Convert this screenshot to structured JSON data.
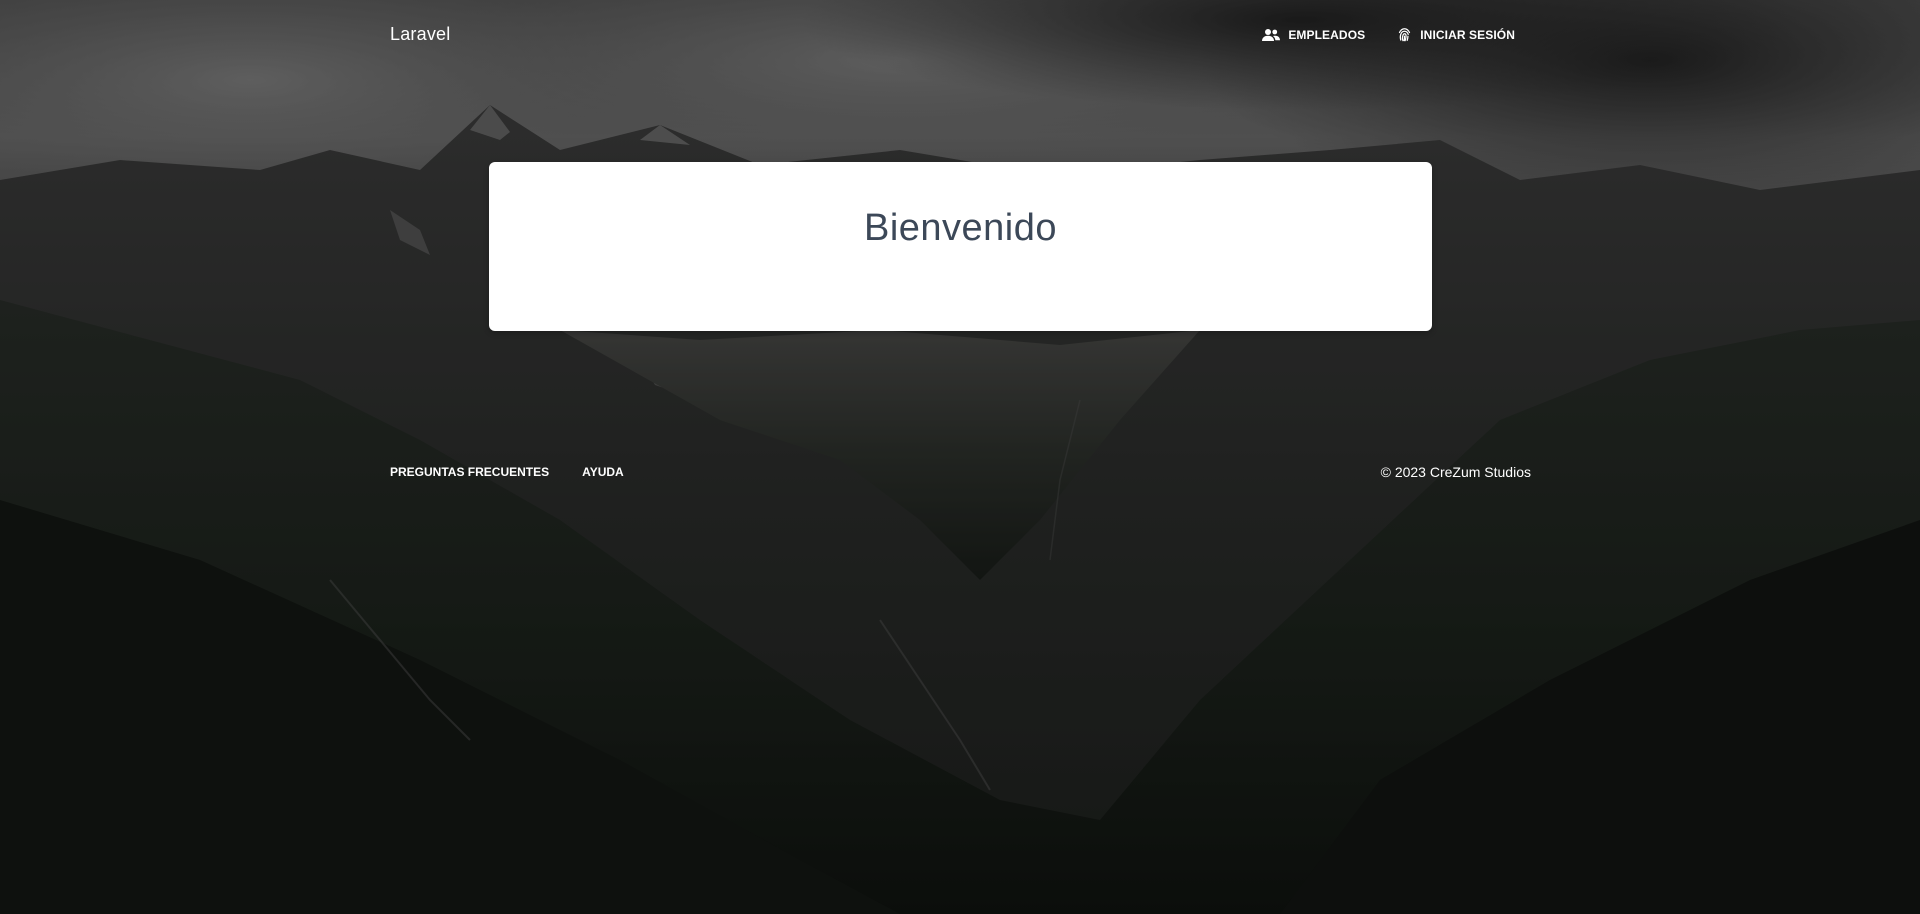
{
  "navbar": {
    "brand": "Laravel",
    "links": [
      {
        "label": "Empleados",
        "icon": "people-icon"
      },
      {
        "label": "Iniciar sesión",
        "icon": "fingerprint-icon"
      }
    ]
  },
  "card": {
    "title": "Bienvenido"
  },
  "footer": {
    "links": [
      {
        "label": "Preguntas frecuentes"
      },
      {
        "label": "Ayuda"
      }
    ],
    "copyright": "© 2023 CreZum Studios"
  },
  "colors": {
    "text_light": "#ffffff",
    "card_title": "#3c4858",
    "card_bg": "#ffffff"
  }
}
